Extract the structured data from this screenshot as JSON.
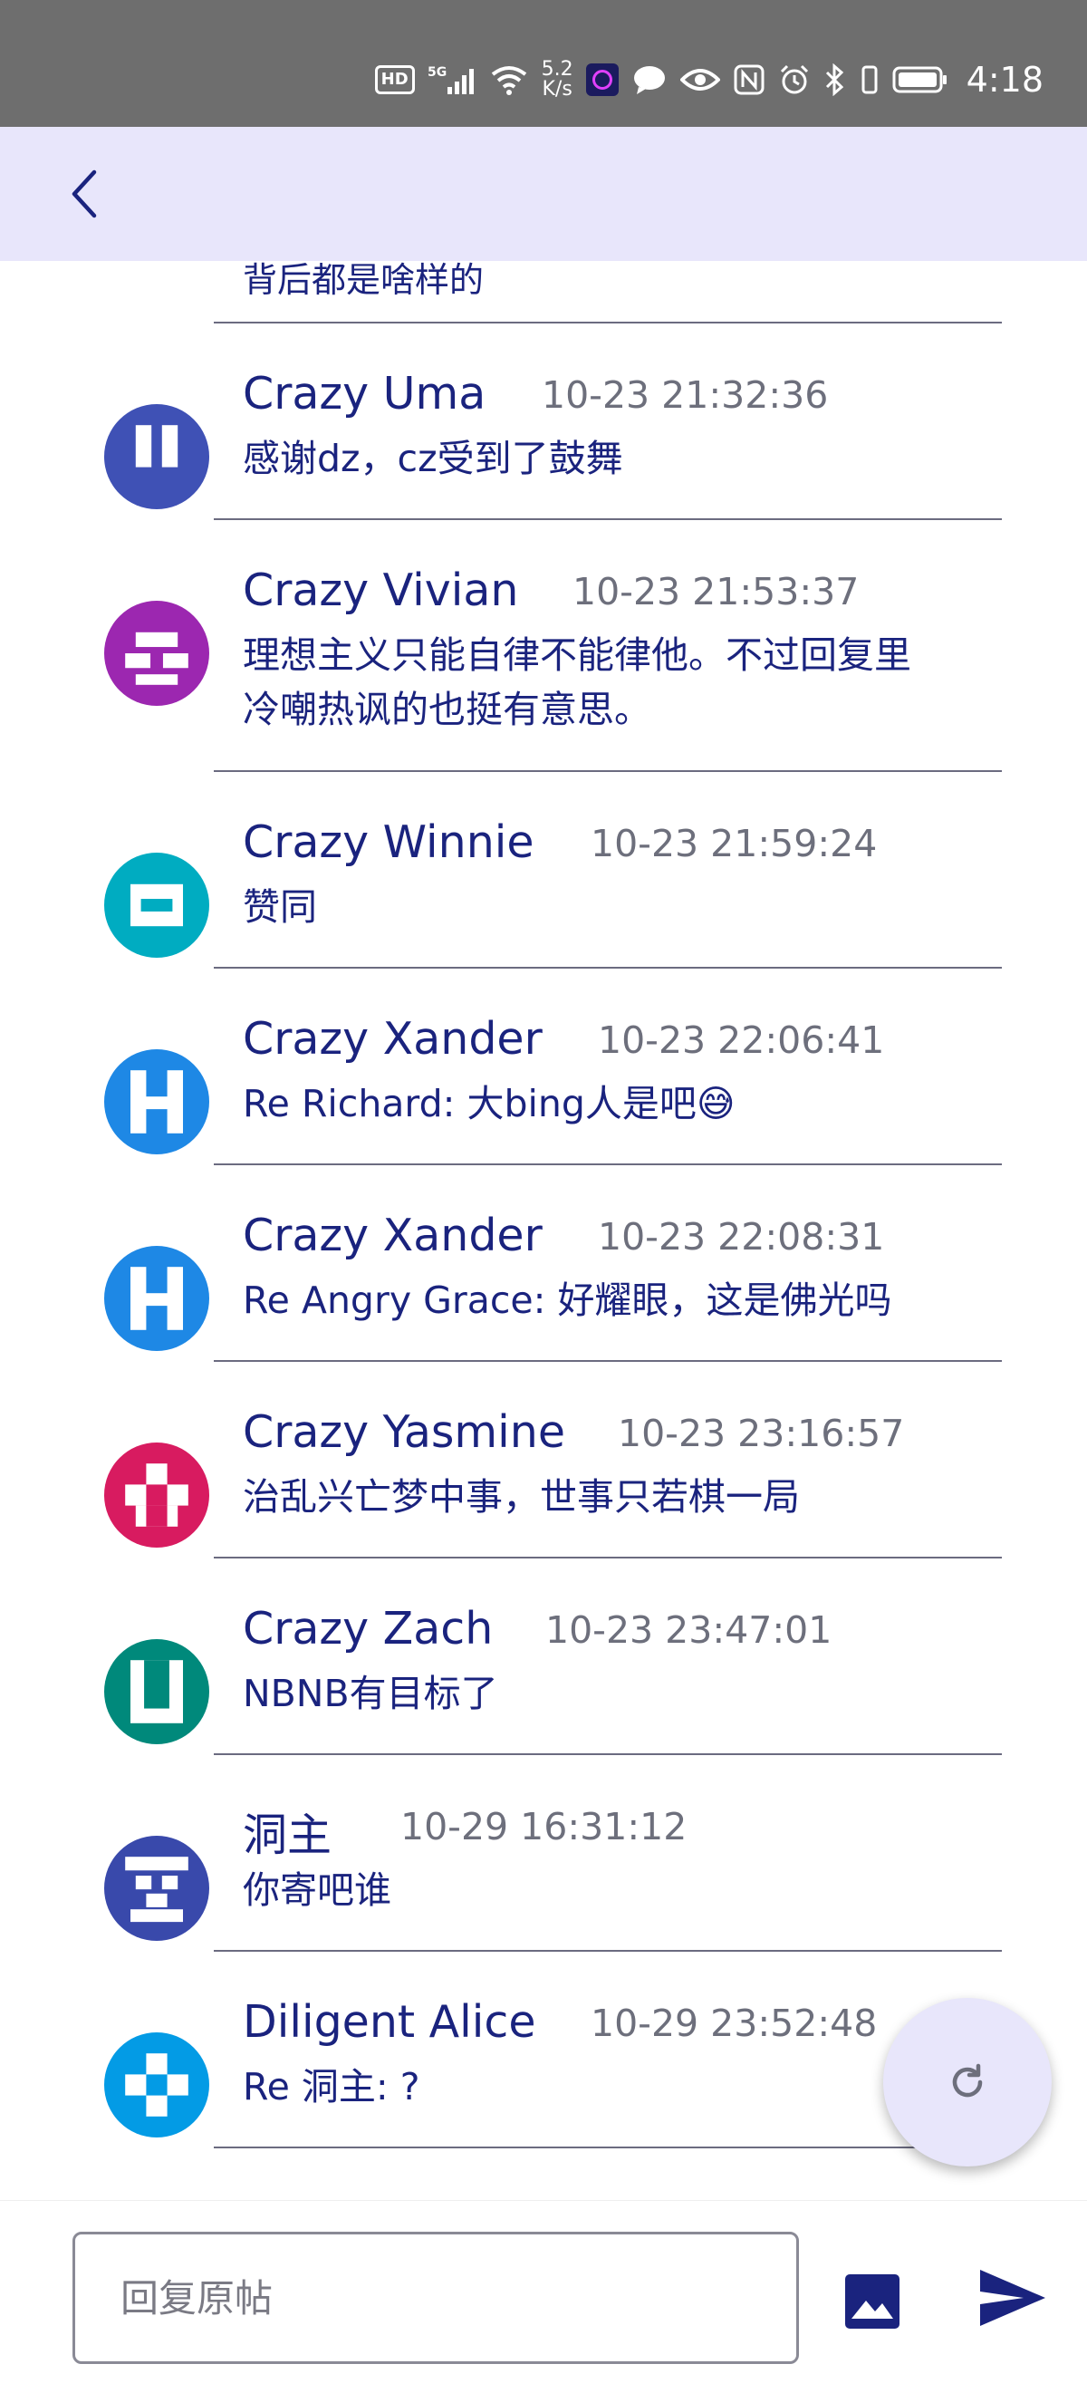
{
  "status_bar": {
    "hd": "HD",
    "network": "5G",
    "speed_value": "5.2",
    "speed_unit": "K/s",
    "time": "4:18"
  },
  "app_bar": {
    "back_icon": "chevron-left-icon"
  },
  "thread": {
    "partial_text": "背后都是啥样的",
    "comments": [
      {
        "name": "Crazy Uma",
        "time": "10-23 21:32:36",
        "text": "感谢dz，cz受到了鼓舞",
        "avatar_color": "#3f51b5"
      },
      {
        "name": "Crazy Vivian",
        "time": "10-23 21:53:37",
        "text": "理想主义只能自律不能律他。不过回复里冷嘲热讽的也挺有意思。",
        "avatar_color": "#9c27b0"
      },
      {
        "name": "Crazy Winnie",
        "time": "10-23 21:59:24",
        "text": "赞同",
        "avatar_color": "#00acc1"
      },
      {
        "name": "Crazy Xander",
        "time": "10-23 22:06:41",
        "text": "Re Richard: 大bing人是吧😅",
        "avatar_color": "#1e88e5"
      },
      {
        "name": "Crazy Xander",
        "time": "10-23 22:08:31",
        "text": "Re Angry Grace: 好耀眼，这是佛光吗",
        "avatar_color": "#1e88e5"
      },
      {
        "name": "Crazy Yasmine",
        "time": "10-23 23:16:57",
        "text": "治乱兴亡梦中事，世事只若棋一局",
        "avatar_color": "#d81b60"
      },
      {
        "name": "Crazy Zach",
        "time": "10-23 23:47:01",
        "text": "NBNB有目标了",
        "avatar_color": "#00897b"
      },
      {
        "name": "洞主",
        "time": "10-29 16:31:12",
        "text": "你寄吧谁",
        "avatar_color": "#3949ab"
      },
      {
        "name": "Diligent Alice",
        "time": "10-29 23:52:48",
        "text": "Re 洞主: ?",
        "avatar_color": "#039be5"
      }
    ]
  },
  "fab": {
    "icon": "refresh-icon"
  },
  "composer": {
    "placeholder": "回复原帖",
    "value": "",
    "image_icon": "image-icon",
    "send_icon": "send-icon"
  },
  "colors": {
    "accent": "#1a237e",
    "app_bar_bg": "#e8e6fb",
    "status_bar_bg": "#6e6e6e",
    "timestamp": "#6d6f7c"
  }
}
